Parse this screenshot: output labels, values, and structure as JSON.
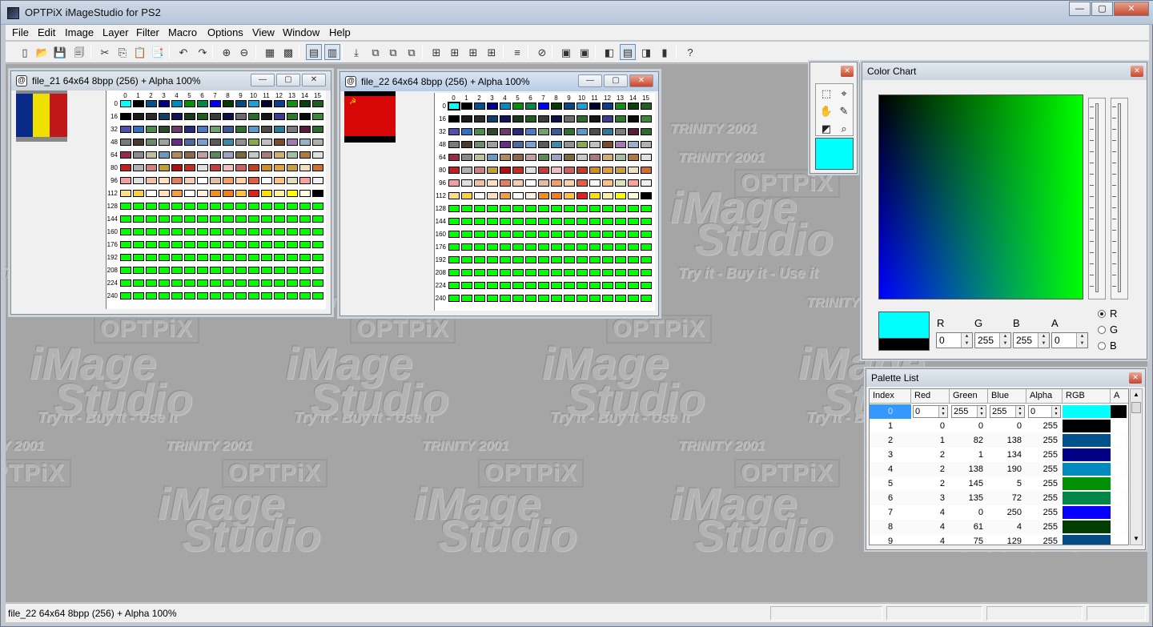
{
  "app": {
    "title": "OPTPiX iMageStudio for PS2"
  },
  "window_controls": {
    "minimize": "—",
    "maximize": "▢",
    "close": "✕"
  },
  "menubar": [
    "File",
    "Edit",
    "Image",
    "Layer",
    "Filter",
    "Macro",
    "Options",
    "View",
    "Window",
    "Help"
  ],
  "toolbar": {
    "icons": [
      "new-icon",
      "open-icon",
      "save-icon",
      "save-all-icon",
      "cut-icon",
      "copy-icon",
      "paste-icon",
      "paste-special-icon",
      "undo-icon",
      "redo-icon",
      "zoom-in-icon",
      "zoom-out-icon",
      "grid-icon",
      "grid-off-icon",
      "palette-view-icon",
      "palette-active-icon",
      "import-icon",
      "layout1-icon",
      "layout2-icon",
      "layout3-icon",
      "tile1-icon",
      "tile2-icon",
      "tile3-icon",
      "tile4-icon",
      "list-icon",
      "stop-icon",
      "convert1-icon",
      "convert2-icon",
      "view1-icon",
      "view2-icon",
      "view3-icon",
      "device-icon",
      "help-icon"
    ]
  },
  "watermark": {
    "line1": "Try it - Buy it - Use it",
    "line2": "TRINITY 2001",
    "line3": "OPTPiX",
    "line4": "iMage",
    "line5": "Studio"
  },
  "doc1": {
    "title": "file_21  64x64  8bpp (256) + Alpha 100%",
    "flag_colors": [
      "#0a2a8a",
      "#f0e000",
      "#c01818"
    ]
  },
  "doc2": {
    "title": "file_22  64x64  8bpp (256) + Alpha 100%",
    "flag_colors": [
      "#d80808",
      "#000000"
    ]
  },
  "palette_grid": {
    "col_headers": [
      "0",
      "1",
      "2",
      "3",
      "4",
      "5",
      "6",
      "7",
      "8",
      "9",
      "10",
      "11",
      "12",
      "13",
      "14",
      "15"
    ],
    "row_headers": [
      "0",
      "16",
      "32",
      "48",
      "64",
      "80",
      "96",
      "112",
      "128",
      "144",
      "160",
      "176",
      "192",
      "208",
      "224",
      "240"
    ],
    "rows": [
      [
        "#00ffff",
        "#000000",
        "#00528a",
        "#010186",
        "#008abe",
        "#029105",
        "#038748",
        "#0000fa",
        "#043d04",
        "#044b81",
        "#1e9fd8",
        "#000033",
        "#0a3d8a",
        "#109010",
        "#0a4010",
        "#1f5f1f"
      ],
      [
        "#000000",
        "#1a1a1a",
        "#2a2a2a",
        "#0c3f6a",
        "#12125a",
        "#183a18",
        "#1c5c1c",
        "#3a3a3a",
        "#0f0f4a",
        "#6a6a6a",
        "#2a6a2a",
        "#151515",
        "#3c3c8c",
        "#2a7a2a",
        "#0a0a0a",
        "#3a8a3a"
      ],
      [
        "#5050b0",
        "#3070c0",
        "#4a8a4a",
        "#2a4a2a",
        "#6a3a6a",
        "#2a2a7a",
        "#4a7ac0",
        "#70a070",
        "#3a5a9a",
        "#2f6f2f",
        "#5a9aca",
        "#4c4c4c",
        "#2a7a9a",
        "#7a7a7a",
        "#5a1a3a",
        "#2c6c2c"
      ],
      [
        "#7a7a7a",
        "#4a3a2a",
        "#6a8a6a",
        "#a0a0a0",
        "#6a2a8a",
        "#4a6aa0",
        "#7aa0d0",
        "#5a5a5a",
        "#3a8aaa",
        "#909090",
        "#8aaa4a",
        "#c0c0c0",
        "#7a4a2a",
        "#a07ab0",
        "#9ab0c8",
        "#b0b0b0"
      ],
      [
        "#9a2a4a",
        "#8a8a8a",
        "#c0c0a0",
        "#6a9ac0",
        "#b08a5a",
        "#8a6a4a",
        "#c0a0a0",
        "#5a8a5a",
        "#a0a0c0",
        "#7a6a3a",
        "#c8c8c8",
        "#aa7a7a",
        "#d0b070",
        "#a0c0a0",
        "#b07a3a",
        "#e0e0e0"
      ],
      [
        "#c02020",
        "#b0b0b0",
        "#d08080",
        "#c0a030",
        "#b01010",
        "#c03020",
        "#e0e0e0",
        "#c04040",
        "#f0c0c0",
        "#d06060",
        "#c04020",
        "#d09020",
        "#e0a040",
        "#c8a040",
        "#f0e0c0",
        "#d07030"
      ],
      [
        "#f0a0a0",
        "#e0e0e0",
        "#f0c0a0",
        "#ffe0c0",
        "#e08060",
        "#f0d0b0",
        "#ffffff",
        "#e0c0a0",
        "#f0a060",
        "#ffd0a0",
        "#e06040",
        "#f8f8f8",
        "#ffc080",
        "#e0e0c0",
        "#ffa0a0",
        "#f0f0f0"
      ],
      [
        "#ffe080",
        "#f8d040",
        "#ffffff",
        "#ffe0c0",
        "#f0a040",
        "#ffffff",
        "#fff0e0",
        "#f09020",
        "#f08020",
        "#ffc040",
        "#e02020",
        "#ffe000",
        "#fff0a0",
        "#ffff00",
        "#ffffe0",
        "#000000"
      ]
    ],
    "fill_color": "#00ff00"
  },
  "toolwin": {
    "tools": [
      "rect-select-icon",
      "crosshair-icon",
      "hand-icon",
      "pencil-icon",
      "fill-icon",
      "zoom-icon"
    ],
    "tool_glyphs": [
      "⬚",
      "⌖",
      "✋",
      "✎",
      "◩",
      "⌕"
    ],
    "current_color": "#00ffff"
  },
  "color_chart": {
    "title": "Color Chart",
    "labels": {
      "r": "R",
      "g": "G",
      "b": "B",
      "a": "A"
    },
    "values": {
      "r": "0",
      "g": "255",
      "b": "255",
      "a": "0"
    },
    "radio": {
      "r": "R",
      "g": "G",
      "b": "B",
      "selected": "R"
    },
    "swatch_fg": "#00ffff",
    "swatch_bg": "#000000"
  },
  "palette_list": {
    "title": "Palette List",
    "headers": [
      "Index",
      "Red",
      "Green",
      "Blue",
      "Alpha",
      "RGB",
      "A"
    ],
    "rows": [
      {
        "index": "0",
        "red": "0",
        "green": "255",
        "blue": "255",
        "alpha": "0",
        "rgb": "#00ffff",
        "a": "#000000"
      },
      {
        "index": "1",
        "red": "0",
        "green": "0",
        "blue": "0",
        "alpha": "255",
        "rgb": "#000000",
        "a": "#ffffff"
      },
      {
        "index": "2",
        "red": "1",
        "green": "82",
        "blue": "138",
        "alpha": "255",
        "rgb": "#01528a",
        "a": "#ffffff"
      },
      {
        "index": "3",
        "red": "2",
        "green": "1",
        "blue": "134",
        "alpha": "255",
        "rgb": "#020186",
        "a": "#ffffff"
      },
      {
        "index": "4",
        "red": "2",
        "green": "138",
        "blue": "190",
        "alpha": "255",
        "rgb": "#028abe",
        "a": "#ffffff"
      },
      {
        "index": "5",
        "red": "2",
        "green": "145",
        "blue": "5",
        "alpha": "255",
        "rgb": "#029105",
        "a": "#ffffff"
      },
      {
        "index": "6",
        "red": "3",
        "green": "135",
        "blue": "72",
        "alpha": "255",
        "rgb": "#038748",
        "a": "#ffffff"
      },
      {
        "index": "7",
        "red": "4",
        "green": "0",
        "blue": "250",
        "alpha": "255",
        "rgb": "#0400fa",
        "a": "#ffffff"
      },
      {
        "index": "8",
        "red": "4",
        "green": "61",
        "blue": "4",
        "alpha": "255",
        "rgb": "#043d04",
        "a": "#ffffff"
      },
      {
        "index": "9",
        "red": "4",
        "green": "75",
        "blue": "129",
        "alpha": "255",
        "rgb": "#044b81",
        "a": "#ffffff"
      }
    ]
  },
  "statusbar": {
    "text": "file_22  64x64  8bpp (256) + Alpha 100%"
  }
}
